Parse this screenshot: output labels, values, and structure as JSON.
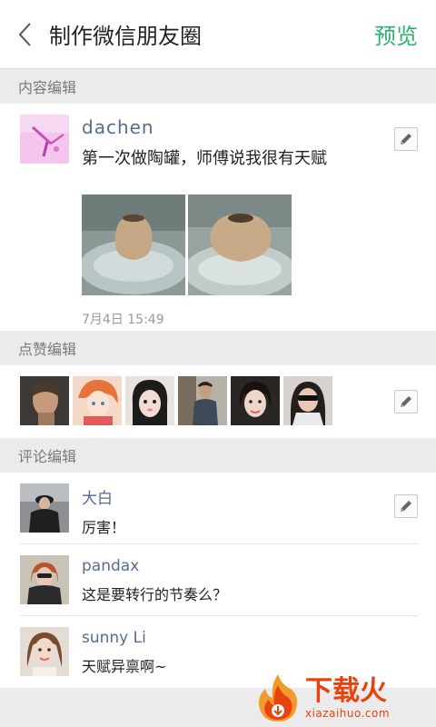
{
  "header": {
    "title": "制作微信朋友圈",
    "preview_label": "预览"
  },
  "sections": {
    "content": "内容编辑",
    "likes": "点赞编辑",
    "comments": "评论编辑"
  },
  "post": {
    "username": "dachen",
    "text": "第一次做陶罐，师傅说我很有天赋",
    "date": "7月4日 15:49"
  },
  "likes": [
    "liker-1",
    "liker-2",
    "liker-3",
    "liker-4",
    "liker-5",
    "liker-6"
  ],
  "comments": [
    {
      "name": "大白",
      "text": "厉害！"
    },
    {
      "name": "pandax",
      "text": "这是要转行的节奏么？"
    },
    {
      "name": "sunny Li",
      "text": "天赋异禀啊~"
    }
  ],
  "watermark": {
    "cn": "下载火",
    "url": "xiazaihuo.com"
  },
  "colors": {
    "accent": "#2bb26a",
    "name": "#576b95",
    "brand": "#e8430f"
  }
}
